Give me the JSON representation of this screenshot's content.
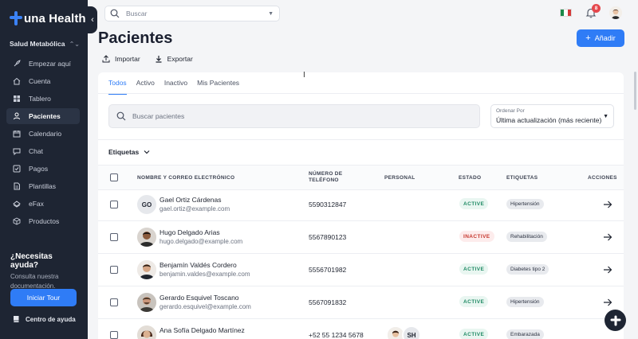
{
  "app": {
    "name": "una Health"
  },
  "sidebar": {
    "org": "Salud Metabólica",
    "items": [
      {
        "label": "Empezar aquí",
        "icon": "rocket-icon"
      },
      {
        "label": "Cuenta",
        "icon": "home-icon"
      },
      {
        "label": "Tablero",
        "icon": "dashboard-icon"
      },
      {
        "label": "Pacientes",
        "icon": "users-icon",
        "active": true
      },
      {
        "label": "Calendario",
        "icon": "calendar-icon"
      },
      {
        "label": "Chat",
        "icon": "chat-icon"
      },
      {
        "label": "Pagos",
        "icon": "payments-icon"
      },
      {
        "label": "Plantillas",
        "icon": "template-icon"
      },
      {
        "label": "eFax",
        "icon": "fax-icon"
      },
      {
        "label": "Productos",
        "icon": "products-icon"
      }
    ],
    "help_title": "¿Necesitas ayuda?",
    "help_text": "Consulta nuestra documentación.",
    "tour_label": "Iniciar Tour",
    "help_center_label": "Centro de ayuda"
  },
  "topbar": {
    "search_placeholder": "Buscar",
    "notification_count": "8"
  },
  "page": {
    "title": "Pacientes",
    "add_label": "Añadir",
    "import_label": "Importar",
    "export_label": "Exportar"
  },
  "tabs": [
    "Todos",
    "Activo",
    "Inactivo",
    "Mis Pacientes"
  ],
  "filters": {
    "search_placeholder": "Buscar pacientes",
    "order_label": "Ordenar Por",
    "order_value": "Última actualización (más reciente)",
    "tags_label": "Etiquetas"
  },
  "table": {
    "headers": {
      "name": "NOMBRE Y CORREO ELECTRÓNICO",
      "phone_1": "NÚMERO DE",
      "phone_2": "TELÉFONO",
      "staff": "PERSONAL",
      "status": "ESTADO",
      "tags": "ETIQUETAS",
      "actions": "ACCIONES"
    },
    "rows": [
      {
        "initials": "GO",
        "name": "Gael Ortiz Cárdenas",
        "email": "gael.ortiz@example.com",
        "phone": "5590312847",
        "status": "ACTIVE",
        "tag": "Hipertensión"
      },
      {
        "initials": "",
        "name": "Hugo Delgado Arias",
        "email": "hugo.delgado@example.com",
        "phone": "5567890123",
        "status": "INACTIVE",
        "tag": "Rehabilitación"
      },
      {
        "initials": "",
        "name": "Benjamín Valdés Cordero",
        "email": "benjamin.valdes@example.com",
        "phone": "5556701982",
        "status": "ACTIVE",
        "tag": "Diabetes tipo 2"
      },
      {
        "initials": "",
        "name": "Gerardo Esquivel Toscano",
        "email": "gerardo.esquivel@example.com",
        "phone": "5567091832",
        "status": "ACTIVE",
        "tag": "Hipertensión"
      },
      {
        "initials": "",
        "name": "Ana Sofía Delgado Martínez",
        "email": "",
        "phone": "+52 55 1234 5678",
        "status": "ACTIVE",
        "tag": "Embarazada",
        "staff_initials": "SH"
      }
    ]
  }
}
